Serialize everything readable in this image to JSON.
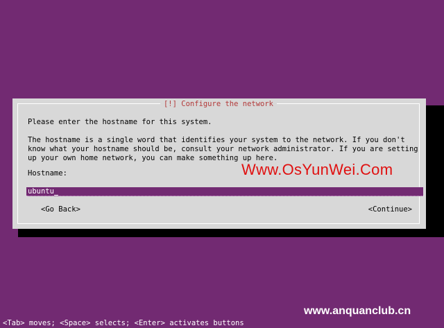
{
  "dialog": {
    "title": "[!] Configure the network",
    "intro": "Please enter the hostname for this system.",
    "description": "The hostname is a single word that identifies your system to the network. If you don't\nknow what your hostname should be, consult your network administrator. If you are setting\nup your own home network, you can make something up here.",
    "field_label": "Hostname:",
    "hostname_value": "ubuntu",
    "buttons": {
      "back": "<Go Back>",
      "continue": "<Continue>"
    }
  },
  "watermarks": {
    "primary": "Www.OsYunWei.Com",
    "secondary": "www.anquanclub.cn"
  },
  "status_bar": "<Tab> moves; <Space> selects; <Enter> activates buttons",
  "colors": {
    "background": "#722a72",
    "dialog": "#d8d8d8",
    "title_text": "#b33a3a",
    "watermark_red": "#e01010"
  }
}
